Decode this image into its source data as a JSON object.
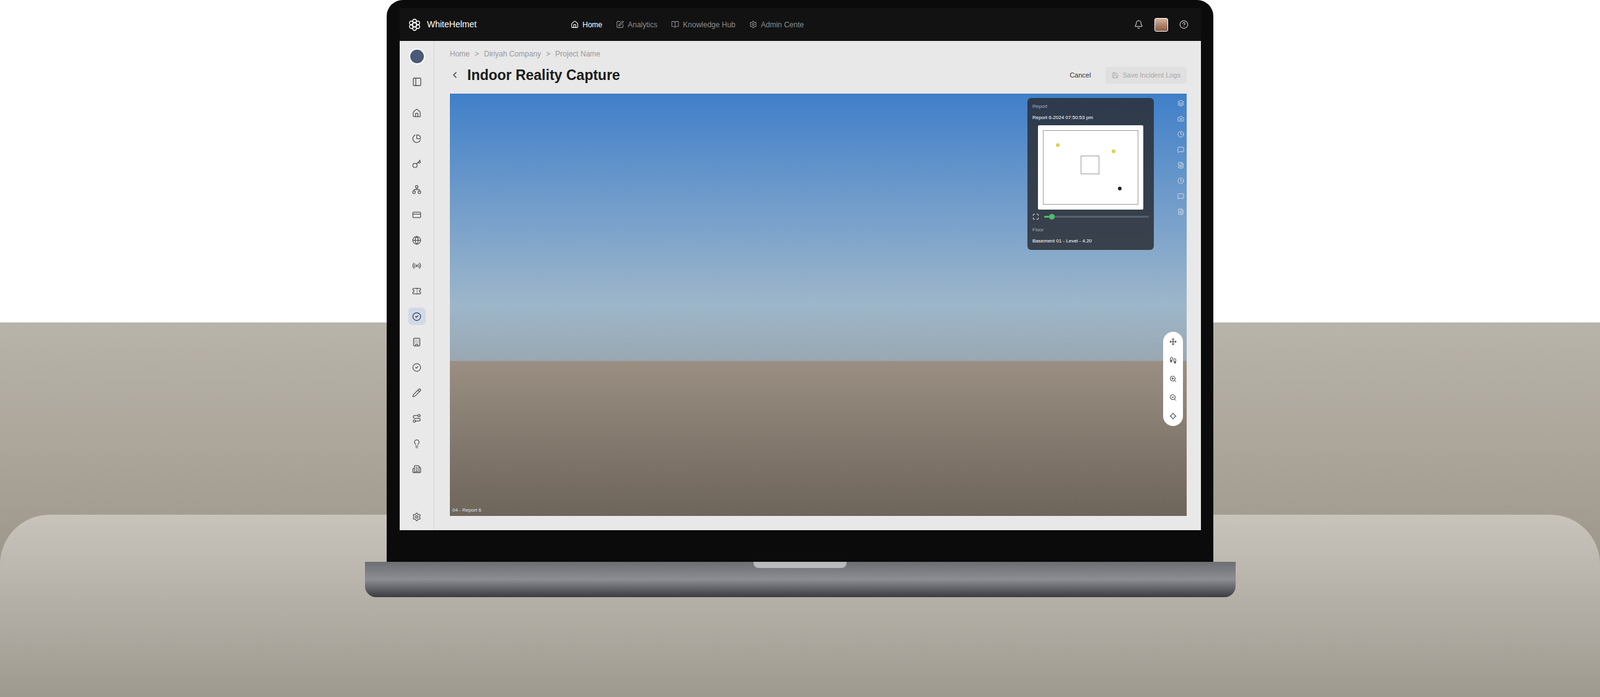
{
  "nav": {
    "brand": "WhiteHelmet",
    "items": [
      {
        "label": "Home",
        "selected": true
      },
      {
        "label": "Analytics",
        "selected": false
      },
      {
        "label": "Knowledge Hub",
        "selected": false
      },
      {
        "label": "Admin Cente",
        "selected": false
      }
    ]
  },
  "sidebar": {
    "items": [
      {
        "selected": false
      },
      {
        "selected": false
      },
      {
        "selected": false
      },
      {
        "selected": false
      },
      {
        "selected": false
      },
      {
        "selected": false
      },
      {
        "selected": false
      },
      {
        "selected": false
      },
      {
        "selected": true
      },
      {
        "selected": false
      },
      {
        "selected": false
      },
      {
        "selected": false
      },
      {
        "selected": false
      },
      {
        "selected": false
      },
      {
        "selected": false
      }
    ]
  },
  "breadcrumb": {
    "separator": ">",
    "items": [
      "Home",
      "Diriyah Company",
      "Project Name"
    ]
  },
  "page": {
    "title": "Indoor Reality Capture"
  },
  "buttons": [
    {
      "label": "Cancel",
      "disabled": false
    },
    {
      "label": "Save Incident Logs",
      "disabled": true
    }
  ],
  "viewer": {
    "report_label": "Report",
    "report_value": "Report 6-2024 07:50:53 pm",
    "floor_label": "Floor",
    "floor_value": "Basement 01 - Level - 4.20",
    "caption": "04 - Report 6",
    "timeline_level": 0.05
  }
}
